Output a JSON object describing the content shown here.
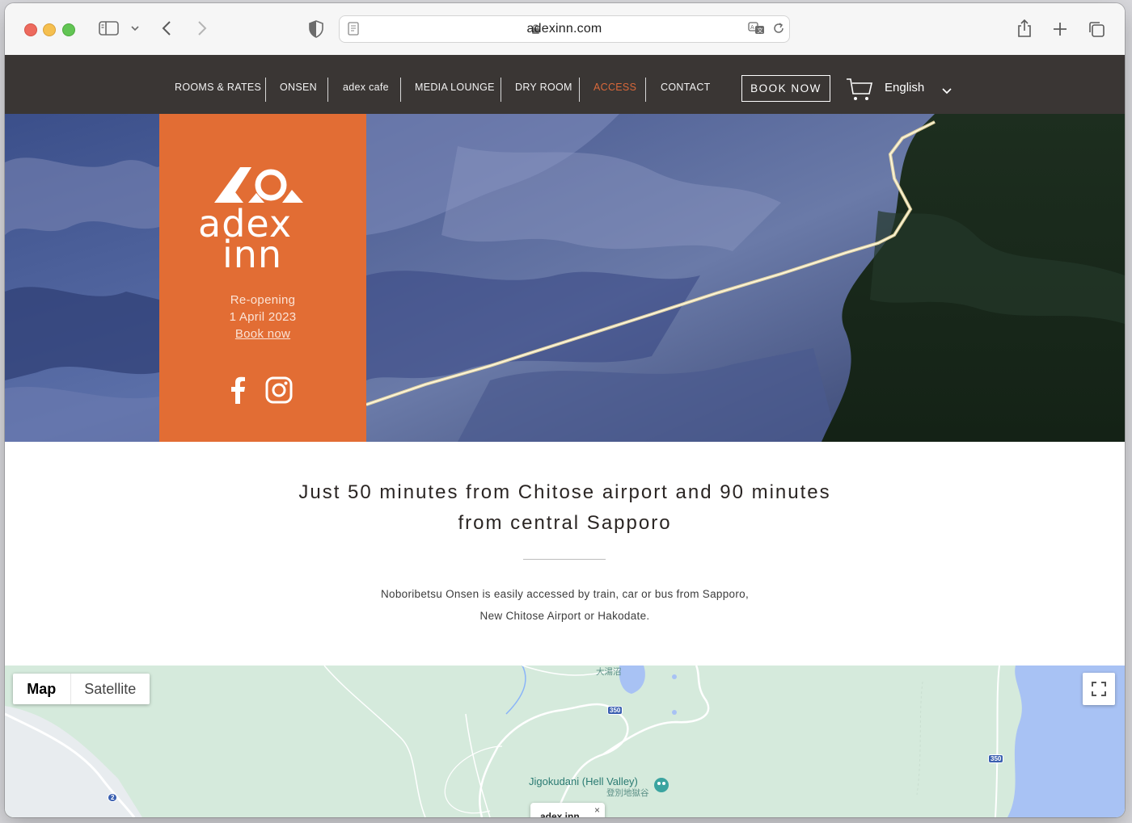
{
  "browser": {
    "url": "adexinn.com"
  },
  "nav": {
    "items": [
      {
        "label": "ROOMS & RATES"
      },
      {
        "label": "ONSEN"
      },
      {
        "label": "adex cafe"
      },
      {
        "label": "MEDIA LOUNGE"
      },
      {
        "label": "DRY ROOM"
      },
      {
        "label": "ACCESS",
        "active": true
      },
      {
        "label": "CONTACT"
      }
    ],
    "book_label": "BOOK NOW",
    "language": "English",
    "active_color": "#d9683a"
  },
  "hero": {
    "logo_text": "adex inn",
    "reopen_line1": "Re-opening",
    "reopen_line2": "1 April 2023",
    "reopen_link": "Book now",
    "panel_color": "#e26d34"
  },
  "content": {
    "headline_line1": "Just 50 minutes from Chitose airport and 90 minutes",
    "headline_line2": "from central Sapporo",
    "para_line1": "Noboribetsu Onsen is easily accessed by train, car or bus from Sapporo,",
    "para_line2": "New Chitose Airport or Hakodate."
  },
  "map": {
    "type_map": "Map",
    "type_satellite": "Satellite",
    "place_label": "Jigokudani (Hell Valley)",
    "place_label_jp": "登別地獄谷",
    "lake_label_jp": "大湯沼",
    "route_350a": "350",
    "route_350b": "350",
    "route_2": "2",
    "pin_card_text": "adex inn",
    "pin_close": "×"
  }
}
